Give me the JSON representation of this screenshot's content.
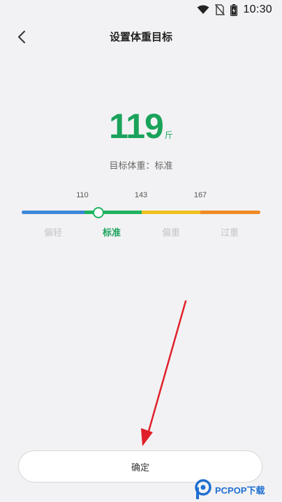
{
  "status_bar": {
    "time": "10:30",
    "icons": [
      "wifi-icon",
      "no-sim-icon",
      "battery-icon"
    ]
  },
  "header": {
    "title": "设置体重目标",
    "back_icon": "chevron-left-icon"
  },
  "weight": {
    "value": "119",
    "unit": "斤",
    "target_label": "目标体重：标准"
  },
  "scale": {
    "ticks": [
      "110",
      "143",
      "167"
    ],
    "categories": [
      "偏轻",
      "标准",
      "偏重",
      "过重"
    ],
    "active_category": "标准",
    "colors": {
      "underweight": "#3b87d9",
      "normal": "#1fb35f",
      "overweight": "#f0c020",
      "obese": "#f08a25"
    }
  },
  "actions": {
    "confirm_label": "确定"
  },
  "annotation": {
    "arrow_color": "#e0202a"
  },
  "watermark": {
    "text": "PCPOP下载"
  }
}
